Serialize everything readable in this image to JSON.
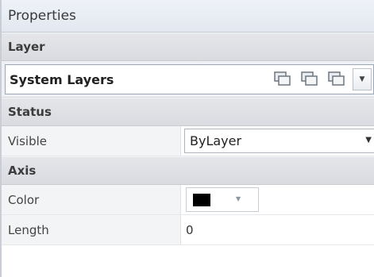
{
  "panel": {
    "title": "Properties"
  },
  "sections": {
    "layer": "Layer",
    "status": "Status",
    "axis": "Axis"
  },
  "layer": {
    "current": "System Layers"
  },
  "properties": {
    "visible": {
      "label": "Visible",
      "value": "ByLayer"
    },
    "color": {
      "label": "Color",
      "value_color": "#000000"
    },
    "length": {
      "label": "Length",
      "value": "0"
    }
  },
  "icons": {
    "layer_tool_1": "layers-icon",
    "layer_tool_2": "layers-icon",
    "layer_tool_3": "layers-icon",
    "dropdown": "chevron-down-icon"
  },
  "colors": {
    "title_bg": "#e8ecf3",
    "section_bg": "#dedfe3",
    "label_bg": "#f3f4f6"
  }
}
